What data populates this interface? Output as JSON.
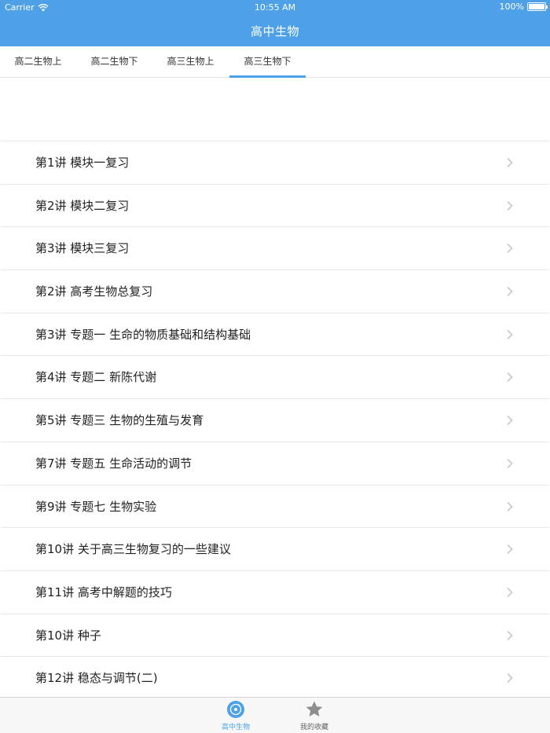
{
  "status_bar": {
    "carrier": "Carrier",
    "time": "10:55 AM",
    "battery": "100%",
    "battery_level": 1.0
  },
  "nav": {
    "title": "高中生物"
  },
  "tabs": [
    {
      "label": "高二生物上",
      "active": false
    },
    {
      "label": "高二生物下",
      "active": false
    },
    {
      "label": "高三生物上",
      "active": false
    },
    {
      "label": "高三生物下",
      "active": true
    }
  ],
  "lessons": [
    {
      "label": "第1讲 模块一复习"
    },
    {
      "label": "第2讲 模块二复习"
    },
    {
      "label": "第3讲 模块三复习"
    },
    {
      "label": "第2讲 高考生物总复习"
    },
    {
      "label": "第3讲 专题一 生命的物质基础和结构基础"
    },
    {
      "label": "第4讲 专题二 新陈代谢"
    },
    {
      "label": "第5讲 专题三 生物的生殖与发育"
    },
    {
      "label": "第7讲 专题五 生命活动的调节"
    },
    {
      "label": "第9讲 专题七 生物实验"
    },
    {
      "label": "第10讲 关于高三生物复习的一些建议"
    },
    {
      "label": "第11讲 高考中解题的技巧"
    },
    {
      "label": "第10讲 种子"
    },
    {
      "label": "第12讲 稳态与调节(二)"
    }
  ],
  "tabbar": {
    "items": [
      {
        "label": "高中生物",
        "icon": "disc-icon",
        "active": true
      },
      {
        "label": "我的收藏",
        "icon": "star-icon",
        "active": false
      }
    ]
  },
  "colors": {
    "accent": "#4ea1e6",
    "inactive_icon": "#8e8e8e",
    "chevron": "#c7c7cc",
    "divider": "#e8e8e8"
  }
}
